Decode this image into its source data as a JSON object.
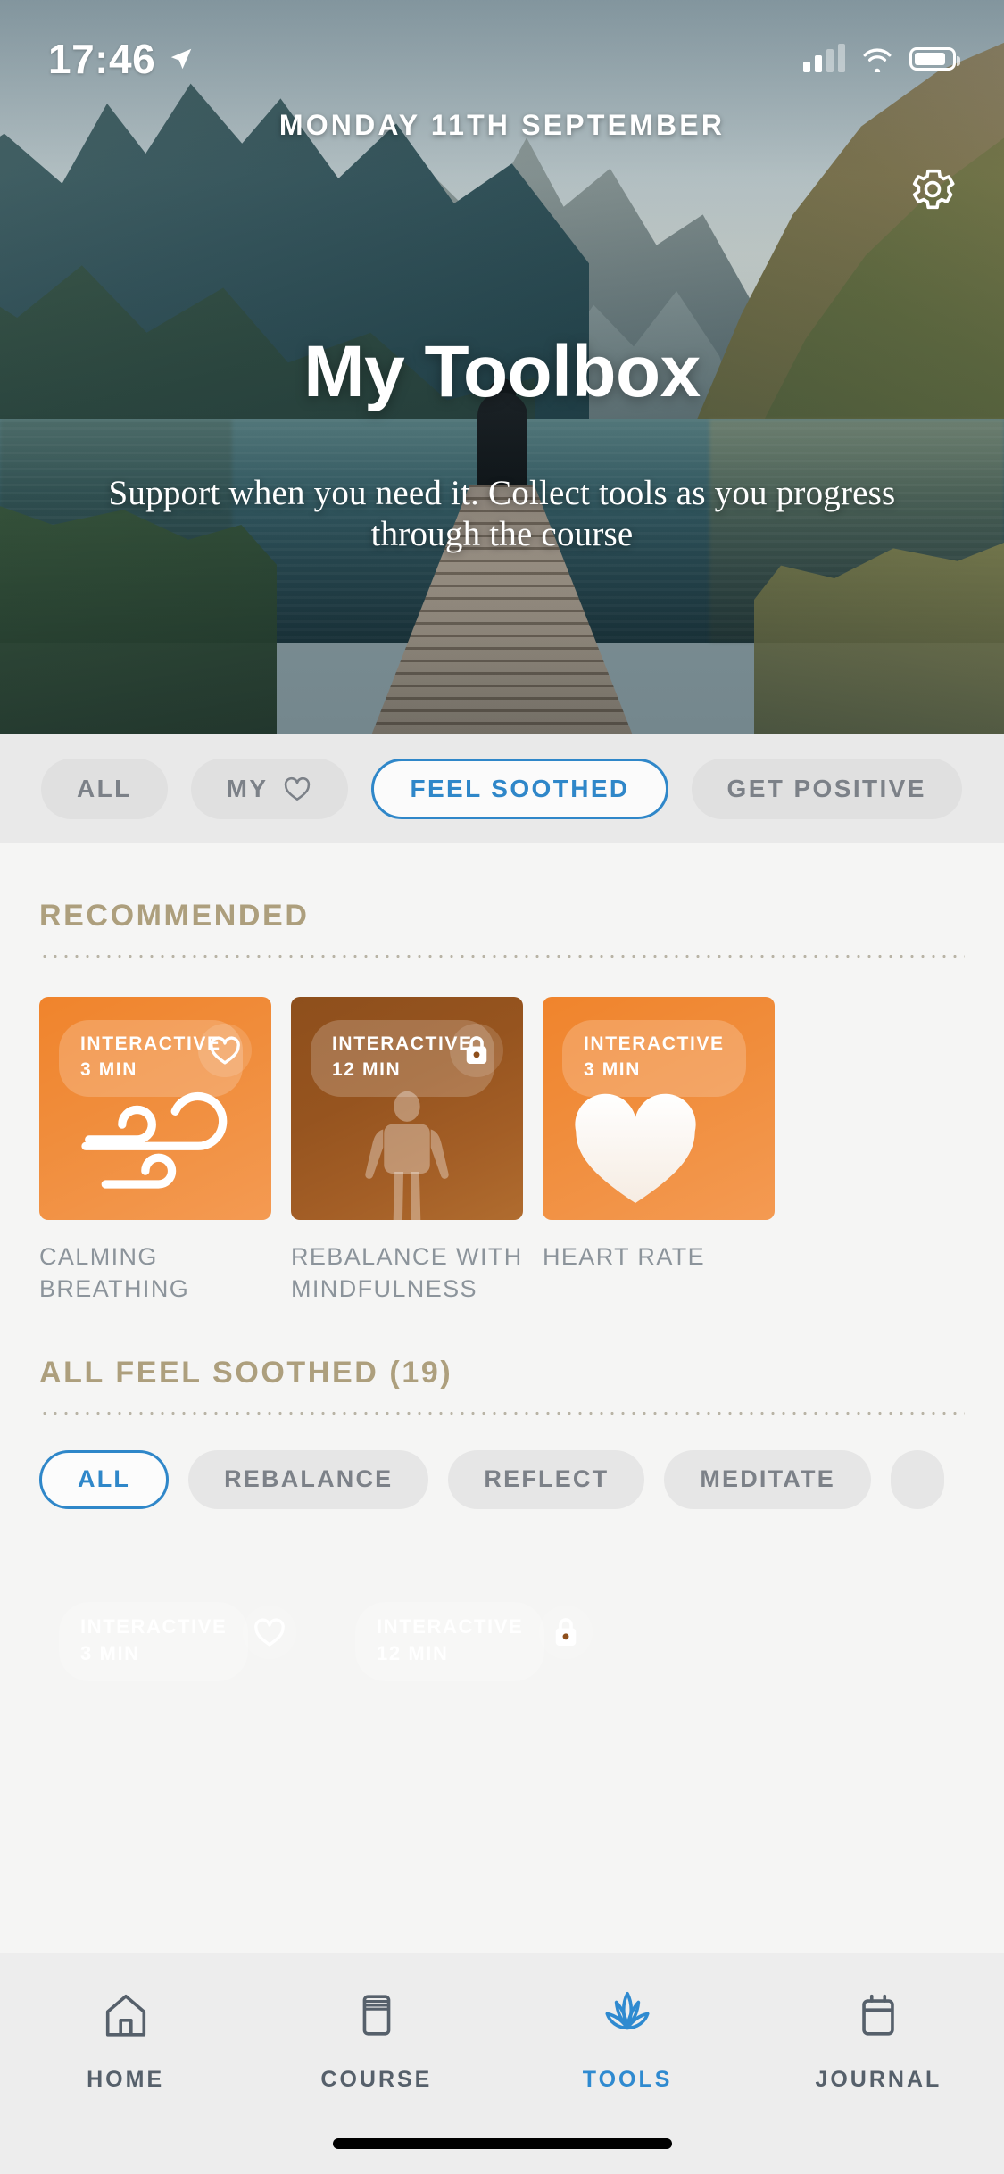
{
  "status_bar": {
    "time": "17:46",
    "location_icon": "location-arrow-icon",
    "cellular_icon": "cellular-signal-icon",
    "wifi_icon": "wifi-icon",
    "battery_icon": "battery-icon"
  },
  "hero": {
    "date": "MONDAY 11TH SEPTEMBER",
    "title": "My Toolbox",
    "subtitle": "Support when you need it. Collect tools as you progress through the course",
    "settings_icon": "gear-icon"
  },
  "category_chips": [
    {
      "label": "ALL",
      "selected": false,
      "icon": null
    },
    {
      "label": "MY",
      "selected": false,
      "icon": "heart-outline-icon"
    },
    {
      "label": "FEEL SOOTHED",
      "selected": true,
      "icon": null
    },
    {
      "label": "GET POSITIVE",
      "selected": false,
      "icon": null
    }
  ],
  "recommended": {
    "heading": "RECOMMENDED",
    "cards": [
      {
        "type": "INTERACTIVE",
        "duration": "3 MIN",
        "title": "CALMING BREATHING",
        "color": "#f0842c",
        "theme": "orange",
        "action_icon": "heart-outline-icon",
        "locked": false,
        "art": "wind-icon"
      },
      {
        "type": "INTERACTIVE",
        "duration": "12 MIN",
        "title": "REBALANCE WITH MINDFULNESS",
        "color": "#96541f",
        "theme": "brown",
        "action_icon": "lock-icon",
        "locked": true,
        "art": "body-figure-icon"
      },
      {
        "type": "INTERACTIVE",
        "duration": "3 MIN",
        "title": "HEART RATE",
        "color": "#f0842c",
        "theme": "orange",
        "action_icon": null,
        "locked": false,
        "art": "heart-filled-icon"
      }
    ]
  },
  "all_section": {
    "heading": "ALL FEEL SOOTHED (19)",
    "count": 19,
    "chips": [
      {
        "label": "ALL",
        "selected": true
      },
      {
        "label": "REBALANCE",
        "selected": false
      },
      {
        "label": "REFLECT",
        "selected": false
      },
      {
        "label": "MEDITATE",
        "selected": false
      }
    ],
    "cards": [
      {
        "type": "INTERACTIVE",
        "duration": "3 MIN",
        "theme": "orange",
        "action_icon": "heart-outline-icon",
        "locked": false
      },
      {
        "type": "INTERACTIVE",
        "duration": "12 MIN",
        "theme": "brown",
        "action_icon": "lock-icon",
        "locked": true
      }
    ]
  },
  "tab_bar": {
    "tabs": [
      {
        "label": "HOME",
        "icon": "house-icon",
        "active": false
      },
      {
        "label": "COURSE",
        "icon": "book-icon",
        "active": false
      },
      {
        "label": "TOOLS",
        "icon": "lotus-icon",
        "active": true
      },
      {
        "label": "JOURNAL",
        "icon": "notebook-icon",
        "active": false
      }
    ]
  },
  "colors": {
    "accent_blue": "#2f87c9",
    "section_gold": "#ad9f7d",
    "card_orange": "#f0842c",
    "card_brown": "#96541f",
    "body_bg": "#f5f5f4",
    "chipbar_bg": "#e9e9e9",
    "tabbar_bg": "#ededed",
    "muted_text": "#8c949b"
  }
}
